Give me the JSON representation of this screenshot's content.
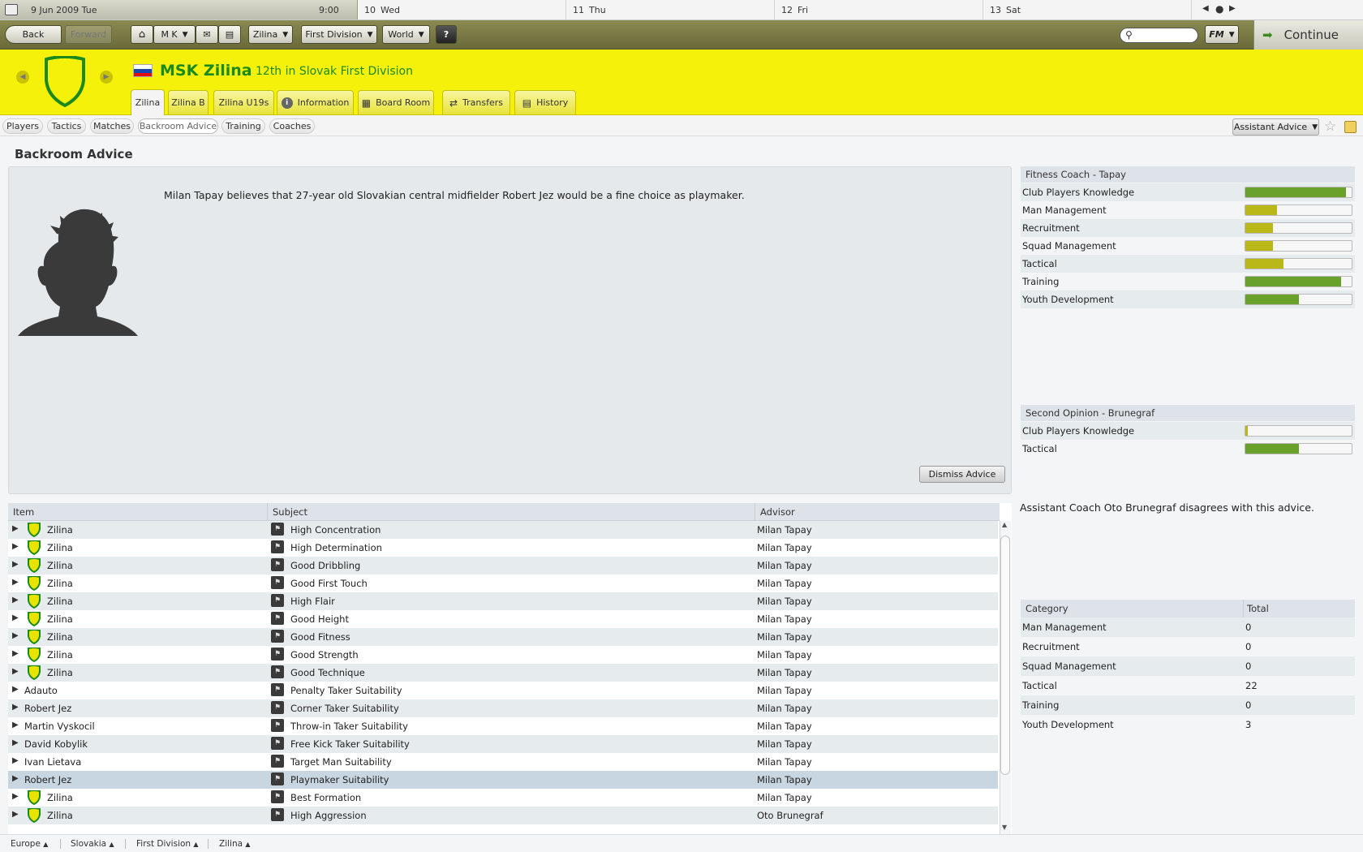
{
  "calendar": {
    "current_date": "9 Jun 2009  Tue",
    "time": "9:00",
    "days": [
      {
        "num": "10",
        "name": "Wed"
      },
      {
        "num": "11",
        "name": "Thu"
      },
      {
        "num": "12",
        "name": "Fri"
      },
      {
        "num": "13",
        "name": "Sat"
      }
    ]
  },
  "toolbar": {
    "back": "Back",
    "forward": "Forward",
    "manager": "M K",
    "club": "Zilina",
    "competition": "First Division",
    "world": "World",
    "help": "?",
    "fm": "FM",
    "continue": "Continue"
  },
  "header": {
    "club_name": "MSK Zilina",
    "position": "12th in Slovak First Division",
    "tabs": [
      "Zilina",
      "Zilina B",
      "Zilina U19s",
      "Information",
      "Board Room",
      "Transfers",
      "History"
    ]
  },
  "subnav": {
    "tabs": [
      "Players",
      "Tactics",
      "Matches",
      "Backroom Advice",
      "Training",
      "Coaches"
    ],
    "assistant_advice": "Assistant Advice"
  },
  "page": {
    "title": "Backroom Advice",
    "advice_text": "Milan Tapay believes that 27-year old Slovakian central midfielder Robert Jez would be a fine choice as playmaker.",
    "dismiss": "Dismiss Advice",
    "disagree": "Assistant Coach Oto Brunegraf disagrees with this advice."
  },
  "advice_table": {
    "headers": [
      "Item",
      "Subject",
      "Advisor"
    ],
    "rows": [
      {
        "item": "Zilina",
        "club": true,
        "subject": "High Concentration",
        "advisor": "Milan Tapay"
      },
      {
        "item": "Zilina",
        "club": true,
        "subject": "High Determination",
        "advisor": "Milan Tapay"
      },
      {
        "item": "Zilina",
        "club": true,
        "subject": "Good Dribbling",
        "advisor": "Milan Tapay"
      },
      {
        "item": "Zilina",
        "club": true,
        "subject": "Good First Touch",
        "advisor": "Milan Tapay"
      },
      {
        "item": "Zilina",
        "club": true,
        "subject": "High Flair",
        "advisor": "Milan Tapay"
      },
      {
        "item": "Zilina",
        "club": true,
        "subject": "Good Height",
        "advisor": "Milan Tapay"
      },
      {
        "item": "Zilina",
        "club": true,
        "subject": "Good Fitness",
        "advisor": "Milan Tapay"
      },
      {
        "item": "Zilina",
        "club": true,
        "subject": "Good Strength",
        "advisor": "Milan Tapay"
      },
      {
        "item": "Zilina",
        "club": true,
        "subject": "Good Technique",
        "advisor": "Milan Tapay"
      },
      {
        "item": "Adauto",
        "club": false,
        "subject": "Penalty Taker Suitability",
        "advisor": "Milan Tapay"
      },
      {
        "item": "Robert Jez",
        "club": false,
        "subject": "Corner Taker Suitability",
        "advisor": "Milan Tapay"
      },
      {
        "item": "Martin Vyskocil",
        "club": false,
        "subject": "Throw-in Taker Suitability",
        "advisor": "Milan Tapay"
      },
      {
        "item": "David Kobylik",
        "club": false,
        "subject": "Free Kick Taker Suitability",
        "advisor": "Milan Tapay"
      },
      {
        "item": "Ivan Lietava",
        "club": false,
        "subject": "Target Man Suitability",
        "advisor": "Milan Tapay"
      },
      {
        "item": "Robert Jez",
        "club": false,
        "subject": "Playmaker Suitability",
        "advisor": "Milan Tapay",
        "selected": true
      },
      {
        "item": "Zilina",
        "club": true,
        "subject": "Best Formation",
        "advisor": "Milan Tapay"
      },
      {
        "item": "Zilina",
        "club": true,
        "subject": "High Aggression",
        "advisor": "Oto Brunegraf"
      }
    ]
  },
  "fitness_coach": {
    "title": "Fitness Coach - Tapay",
    "ratings": [
      {
        "label": "Club Players Knowledge",
        "level": 0.95
      },
      {
        "label": "Man Management",
        "level": 0.3
      },
      {
        "label": "Recruitment",
        "level": 0.26
      },
      {
        "label": "Squad Management",
        "level": 0.26
      },
      {
        "label": "Tactical",
        "level": 0.36
      },
      {
        "label": "Training",
        "level": 0.9
      },
      {
        "label": "Youth Development",
        "level": 0.5
      }
    ]
  },
  "second_opinion": {
    "title": "Second Opinion - Brunegraf",
    "ratings": [
      {
        "label": "Club Players Knowledge",
        "level": 0.02
      },
      {
        "label": "Tactical",
        "level": 0.5
      }
    ]
  },
  "category_table": {
    "headers": [
      "Category",
      "Total"
    ],
    "rows": [
      {
        "category": "Man Management",
        "total": "0"
      },
      {
        "category": "Recruitment",
        "total": "0"
      },
      {
        "category": "Squad Management",
        "total": "0"
      },
      {
        "category": "Tactical",
        "total": "22"
      },
      {
        "category": "Training",
        "total": "0"
      },
      {
        "category": "Youth Development",
        "total": "3"
      }
    ]
  },
  "footer": {
    "crumbs": [
      "Europe",
      "Slovakia",
      "First Division",
      "Zilina"
    ]
  },
  "colors": {
    "header_yellow": "#f5f10a",
    "club_green": "#1a8a1a",
    "bar_green": "#6aa12a",
    "bar_yellow": "#b9b818"
  }
}
